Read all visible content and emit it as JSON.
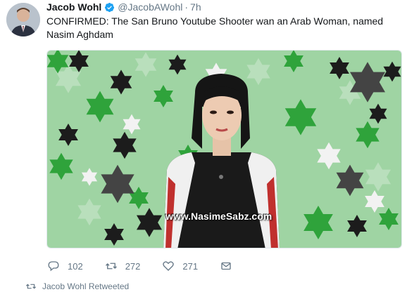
{
  "tweet": {
    "author_name": "Jacob Wohl",
    "author_handle": "@JacobAWohl",
    "separator": "·",
    "time": "7h",
    "text": "CONFIRMED: The San Bruno Youtube Shooter wan an Arab Woman, named Nasim Aghdam",
    "media": {
      "watermark": "www.NasimeSabz.com"
    },
    "actions": {
      "reply_count": "102",
      "retweet_count": "272",
      "like_count": "271"
    }
  },
  "next_item": {
    "retweeted_label": "Jacob Wohl Retweeted"
  },
  "colors": {
    "text": "#14171a",
    "muted": "#657786",
    "verified": "#1da1f2",
    "bg_green": "#9fd4a3",
    "star_green": "#2fa33b",
    "star_black": "#1c1c1c",
    "star_white": "#f2f2f2"
  },
  "icons": {
    "verified": "verified-badge-icon",
    "caret": "chevron-down-icon",
    "reply": "reply-icon",
    "retweet": "retweet-icon",
    "like": "heart-icon",
    "dm": "envelope-icon"
  }
}
